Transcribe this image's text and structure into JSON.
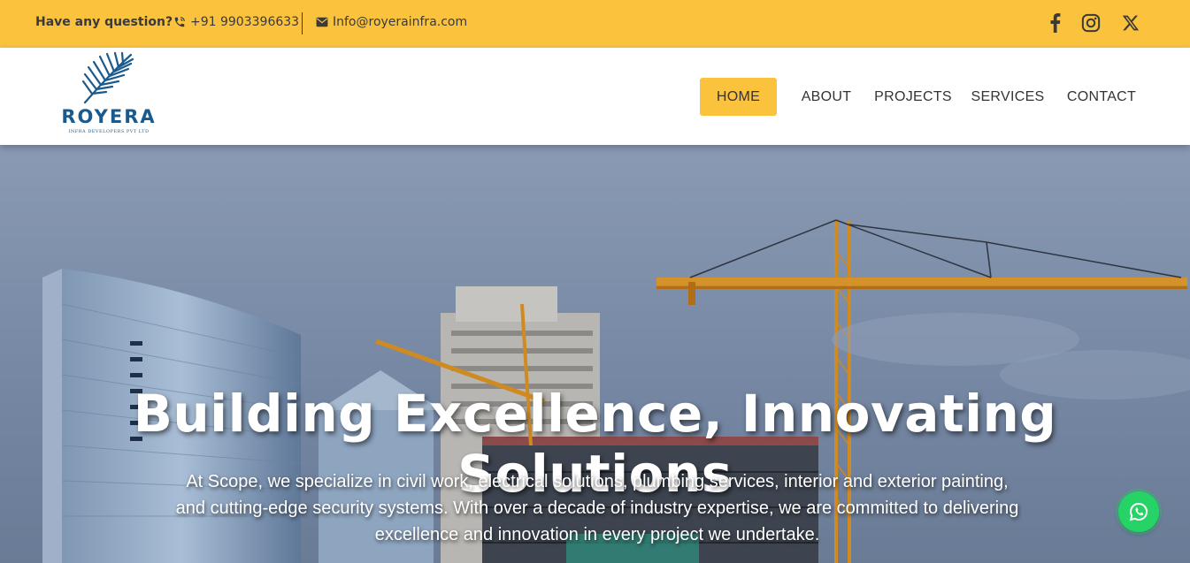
{
  "topbar": {
    "question": "Have any question?",
    "phone": "+91 9903396633",
    "email": "Info@royerainfra.com",
    "social": [
      "facebook-icon",
      "instagram-icon",
      "x-icon"
    ]
  },
  "logo": {
    "brand": "ROYERA",
    "tagline": "INFRA DEVELOPERS PVT LTD"
  },
  "nav": {
    "items": [
      {
        "label": "HOME",
        "active": true
      },
      {
        "label": "ABOUT",
        "active": false
      },
      {
        "label": "PROJECTS",
        "active": false
      },
      {
        "label": "SERVICES",
        "active": false
      },
      {
        "label": "CONTACT",
        "active": false
      }
    ]
  },
  "hero": {
    "title": "Building Excellence, Innovating Solutions",
    "description": "At Scope, we specialize in civil work, electrical solutions, plumbing services, interior and exterior painting, and cutting-edge security systems. With over a decade of industry expertise, we are committed to delivering excellence and innovation in every project we undertake."
  },
  "colors": {
    "accent": "#fbc33d",
    "brand": "#1b5a8c",
    "whatsapp": "#25d366"
  }
}
